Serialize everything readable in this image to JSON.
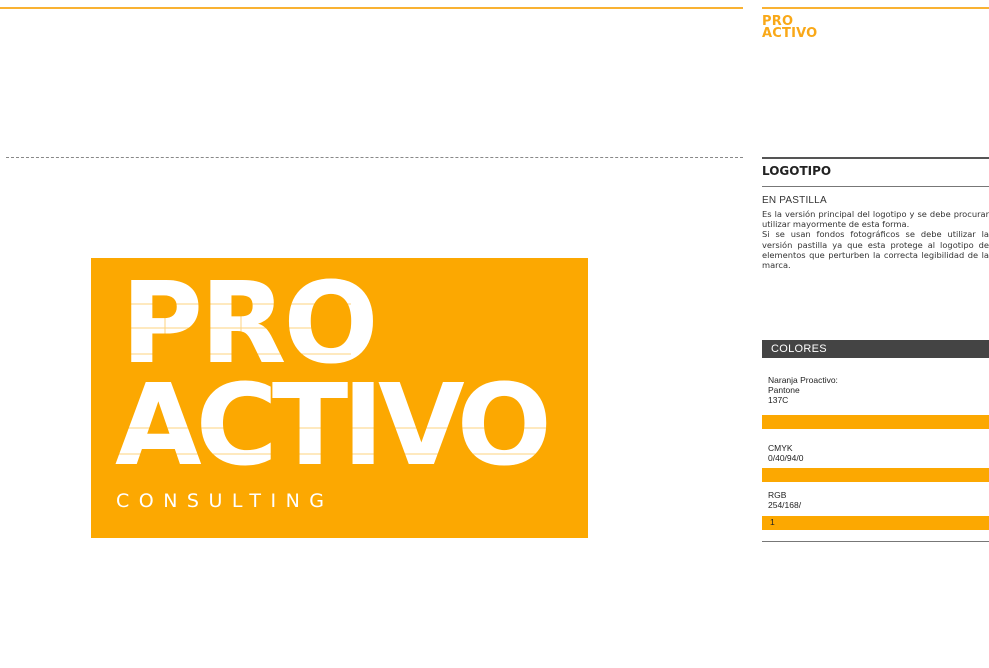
{
  "header": {
    "mini_logo_line1": "PRO",
    "mini_logo_line2": "ACTIVO"
  },
  "logo": {
    "line1": "PRO",
    "line2": "ACTIVO",
    "tagline": "CONSULTING",
    "background_color": "#fca801",
    "text_color": "#ffffff"
  },
  "sidebar": {
    "section_title": "LOGOTIPO",
    "subtitle": "EN PASTILLA",
    "description_p1": "Es la versión principal del logotipo y se debe procurar utilizar mayormente de esta forma.",
    "description_p2": "Si se usan fondos fotográficos se debe utilizar la versión pastilla ya que esta protege al logotipo de elementos que perturben la correcta legibilidad de la marca.",
    "colors_title": "COLORES",
    "colors": [
      {
        "label_line1": "Naranja Proactivo:",
        "label_line2": "Pantone",
        "label_line3": "137C",
        "swatch": "#fca801"
      },
      {
        "label_line1": "CMYK",
        "label_line2": "0/40/94/0",
        "swatch": "#fca801"
      },
      {
        "label_line1": "RGB",
        "label_line2": "254/168/",
        "swatch_text": "1",
        "swatch": "#fca801"
      }
    ]
  },
  "colors": {
    "accent": "#f9a818",
    "dark_bar": "#444444"
  }
}
